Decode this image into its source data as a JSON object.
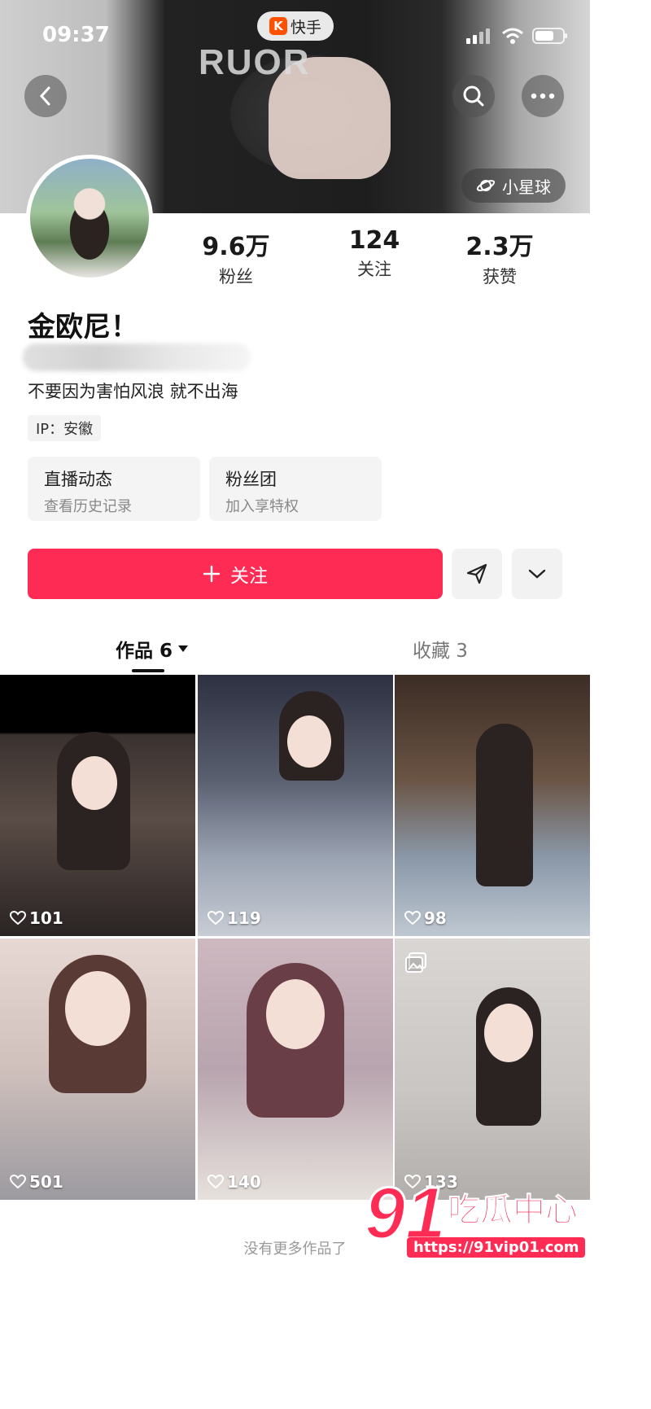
{
  "status": {
    "time": "09:37"
  },
  "app_badge": {
    "label": "快手"
  },
  "cover": {
    "text": "RUOR"
  },
  "header": {
    "planet_label": "小星球"
  },
  "profile": {
    "stats": [
      {
        "value": "9.6万",
        "label": "粉丝"
      },
      {
        "value": "124",
        "label": "关注"
      },
      {
        "value": "2.3万",
        "label": "获赞"
      }
    ],
    "name": "金欧尼！",
    "bio": "不要因为害怕风浪 就不出海",
    "ip": "IP：安徽"
  },
  "cards": [
    {
      "title": "直播动态",
      "subtitle": "查看历史记录"
    },
    {
      "title": "粉丝团",
      "subtitle": "加入享特权"
    }
  ],
  "actions": {
    "follow_label": "关注"
  },
  "tabs": [
    {
      "label": "作品 6"
    },
    {
      "label": "收藏 3"
    }
  ],
  "grid": [
    {
      "likes": "101"
    },
    {
      "likes": "119"
    },
    {
      "likes": "98"
    },
    {
      "likes": "501"
    },
    {
      "likes": "140"
    },
    {
      "likes": "133"
    }
  ],
  "footer": {
    "text": "没有更多作品了"
  },
  "watermark": {
    "number": "91",
    "brand": "吃瓜中心",
    "url": "https://91vip01.com"
  },
  "colors": {
    "accent": "#fe2c55",
    "brand": "#ff5000"
  }
}
